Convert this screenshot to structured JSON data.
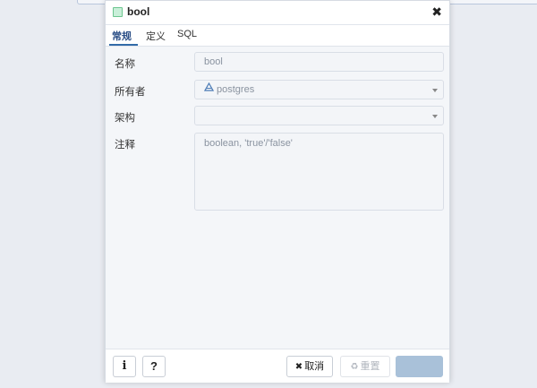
{
  "dialog": {
    "title": "bool",
    "close_glyph": "✖",
    "type_icon": "type-icon"
  },
  "tabs": [
    {
      "label": "常规",
      "active": true
    },
    {
      "label": "定义",
      "active": false
    },
    {
      "label": "SQL",
      "active": false
    }
  ],
  "form": {
    "name_label": "名称",
    "name_value": "bool",
    "owner_label": "所有者",
    "owner_value": "postgres",
    "owner_icon": "user-role-icon",
    "schema_label": "架构",
    "schema_value": "",
    "comment_label": "注释",
    "comment_value": "boolean, 'true'/'false'"
  },
  "footer": {
    "info_label": "i",
    "help_label": "?",
    "cancel_icon": "✖",
    "cancel_label": "取消",
    "reset_icon": "♻",
    "reset_label": "重置",
    "save_label": ""
  },
  "colors": {
    "accent": "#326ba8",
    "save_button": "#a9c1d9",
    "content_bg": "#f4f6f9"
  }
}
